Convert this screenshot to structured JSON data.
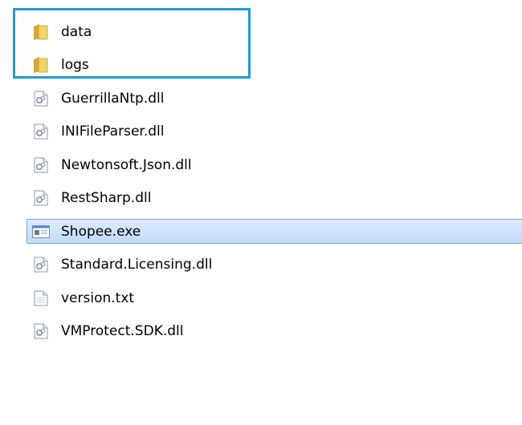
{
  "files": [
    {
      "name": "data",
      "type": "folder",
      "icon": "folder-icon",
      "selected": false
    },
    {
      "name": "logs",
      "type": "folder",
      "icon": "folder-icon",
      "selected": false
    },
    {
      "name": "GuerrillaNtp.dll",
      "type": "dll",
      "icon": "dll-file-icon",
      "selected": false
    },
    {
      "name": "INIFileParser.dll",
      "type": "dll",
      "icon": "dll-file-icon",
      "selected": false
    },
    {
      "name": "Newtonsoft.Json.dll",
      "type": "dll",
      "icon": "dll-file-icon",
      "selected": false
    },
    {
      "name": "RestSharp.dll",
      "type": "dll",
      "icon": "dll-file-icon",
      "selected": false
    },
    {
      "name": "Shopee.exe",
      "type": "exe",
      "icon": "exe-file-icon",
      "selected": true
    },
    {
      "name": "Standard.Licensing.dll",
      "type": "dll",
      "icon": "dll-file-icon",
      "selected": false
    },
    {
      "name": "version.txt",
      "type": "txt",
      "icon": "text-file-icon",
      "selected": false
    },
    {
      "name": "VMProtect.SDK.dll",
      "type": "dll",
      "icon": "dll-file-icon",
      "selected": false
    }
  ],
  "colors": {
    "highlight_border": "#1e9bd7",
    "selection_border": "#7da2ce",
    "selection_fill": "#cce0fb",
    "folder_yellow": "#e8c24a"
  }
}
